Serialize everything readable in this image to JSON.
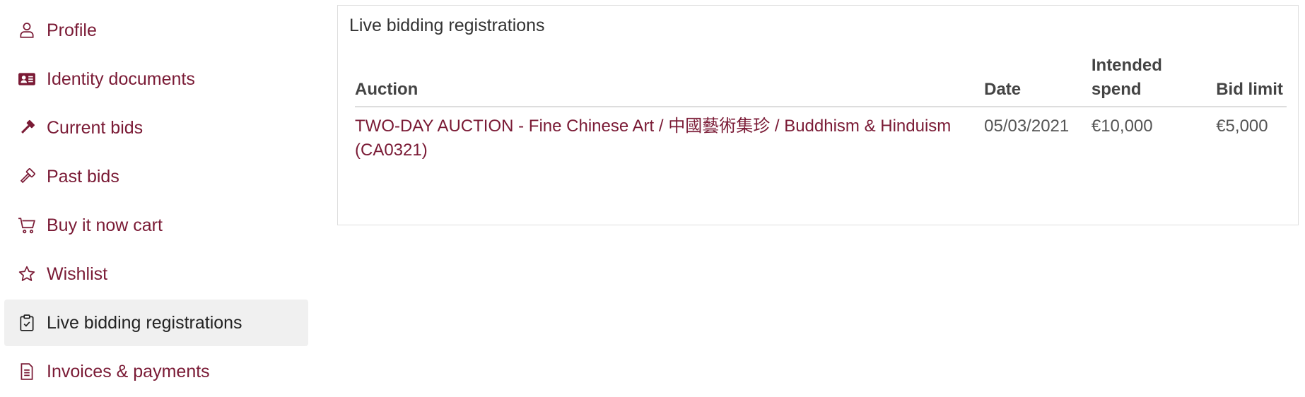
{
  "sidebar": {
    "items": [
      {
        "label": "Profile",
        "icon": "user-icon"
      },
      {
        "label": "Identity documents",
        "icon": "id-card-icon"
      },
      {
        "label": "Current bids",
        "icon": "gavel-filled-icon"
      },
      {
        "label": "Past bids",
        "icon": "gavel-outline-icon"
      },
      {
        "label": "Buy it now cart",
        "icon": "cart-icon"
      },
      {
        "label": "Wishlist",
        "icon": "star-icon"
      },
      {
        "label": "Live bidding registrations",
        "icon": "clipboard-check-icon",
        "active": true
      },
      {
        "label": "Invoices & payments",
        "icon": "invoice-icon"
      }
    ]
  },
  "panel": {
    "title": "Live bidding registrations",
    "columns": {
      "auction": "Auction",
      "date": "Date",
      "spend": "Intended spend",
      "limit": "Bid limit"
    },
    "rows": [
      {
        "auction": "TWO-DAY AUCTION - Fine Chinese Art / 中國藝術集珍 / Buddhism & Hinduism (CA0321)",
        "date": "05/03/2021",
        "spend": "€10,000",
        "limit": "€5,000"
      }
    ]
  },
  "colors": {
    "accent": "#7a1a35",
    "active_bg": "#f0f0f0"
  }
}
